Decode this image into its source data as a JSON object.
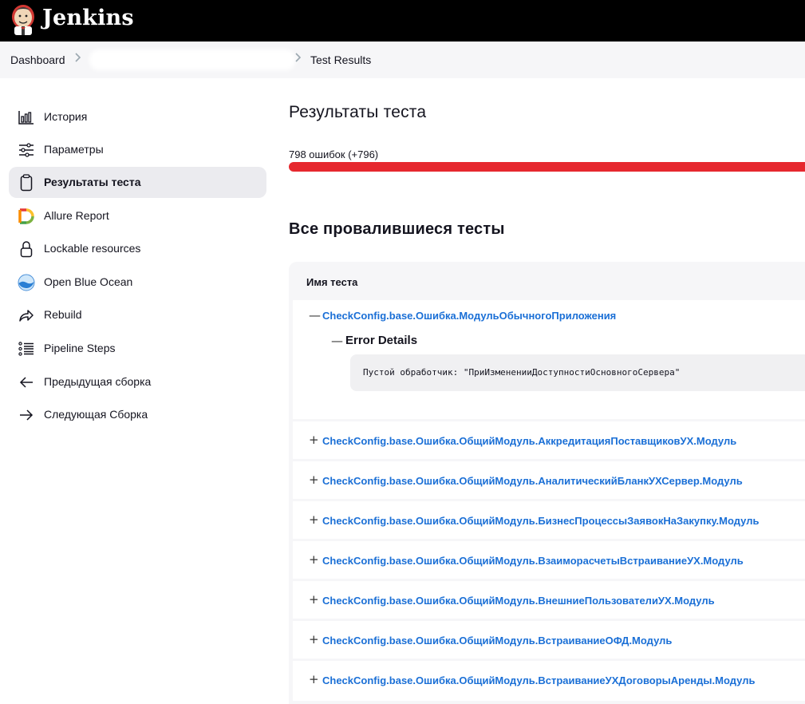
{
  "header": {
    "brand": "Jenkins",
    "logo_icon": "jenkins-butler-icon"
  },
  "breadcrumb": {
    "items": [
      "Dashboard",
      "Test Results"
    ],
    "separator": ">"
  },
  "sidebar": {
    "items": [
      {
        "label": "История",
        "icon": "history-chart-icon"
      },
      {
        "label": "Параметры",
        "icon": "sliders-icon"
      },
      {
        "label": "Результаты теста",
        "icon": "clipboard-icon",
        "active": true
      },
      {
        "label": "Allure Report",
        "icon": "allure-icon"
      },
      {
        "label": "Lockable resources",
        "icon": "lock-icon"
      },
      {
        "label": "Open Blue Ocean",
        "icon": "blue-ocean-icon"
      },
      {
        "label": "Rebuild",
        "icon": "rebuild-arrow-icon"
      },
      {
        "label": "Pipeline Steps",
        "icon": "list-steps-icon"
      },
      {
        "label": "Предыдущая сборка",
        "icon": "arrow-left-icon"
      },
      {
        "label": "Следующая Сборка",
        "icon": "arrow-right-icon"
      }
    ]
  },
  "main": {
    "title": "Результаты теста",
    "summary": "798 ошибок (+796)",
    "failed_section_title": "Все провалившиеся тесты",
    "table_header": "Имя теста",
    "colors": {
      "fail": "#e6282e",
      "link": "#1a6fd6"
    },
    "expanded_row": {
      "toggle": "—",
      "name": "CheckConfig.base.Ошибка.МодульОбычногоПриложения",
      "error_toggle": "—",
      "error_title": "Error Details",
      "error_text": "Пустой обработчик: \"ПриИзмененииДоступностиОсновногоСервера\""
    },
    "rows": [
      {
        "toggle": "+",
        "name": "CheckConfig.base.Ошибка.ОбщийМодуль.АккредитацияПоставщиковУХ.Модуль"
      },
      {
        "toggle": "+",
        "name": "CheckConfig.base.Ошибка.ОбщийМодуль.АналитическийБланкУХСервер.Модуль"
      },
      {
        "toggle": "+",
        "name": "CheckConfig.base.Ошибка.ОбщийМодуль.БизнесПроцессыЗаявокНаЗакупку.Модуль"
      },
      {
        "toggle": "+",
        "name": "CheckConfig.base.Ошибка.ОбщийМодуль.ВзаиморасчетыВстраиваниеУХ.Модуль"
      },
      {
        "toggle": "+",
        "name": "CheckConfig.base.Ошибка.ОбщийМодуль.ВнешниеПользователиУХ.Модуль"
      },
      {
        "toggle": "+",
        "name": "CheckConfig.base.Ошибка.ОбщийМодуль.ВстраиваниеОФД.Модуль"
      },
      {
        "toggle": "+",
        "name": "CheckConfig.base.Ошибка.ОбщийМодуль.ВстраиваниеУХДоговорыАренды.Модуль"
      }
    ]
  }
}
